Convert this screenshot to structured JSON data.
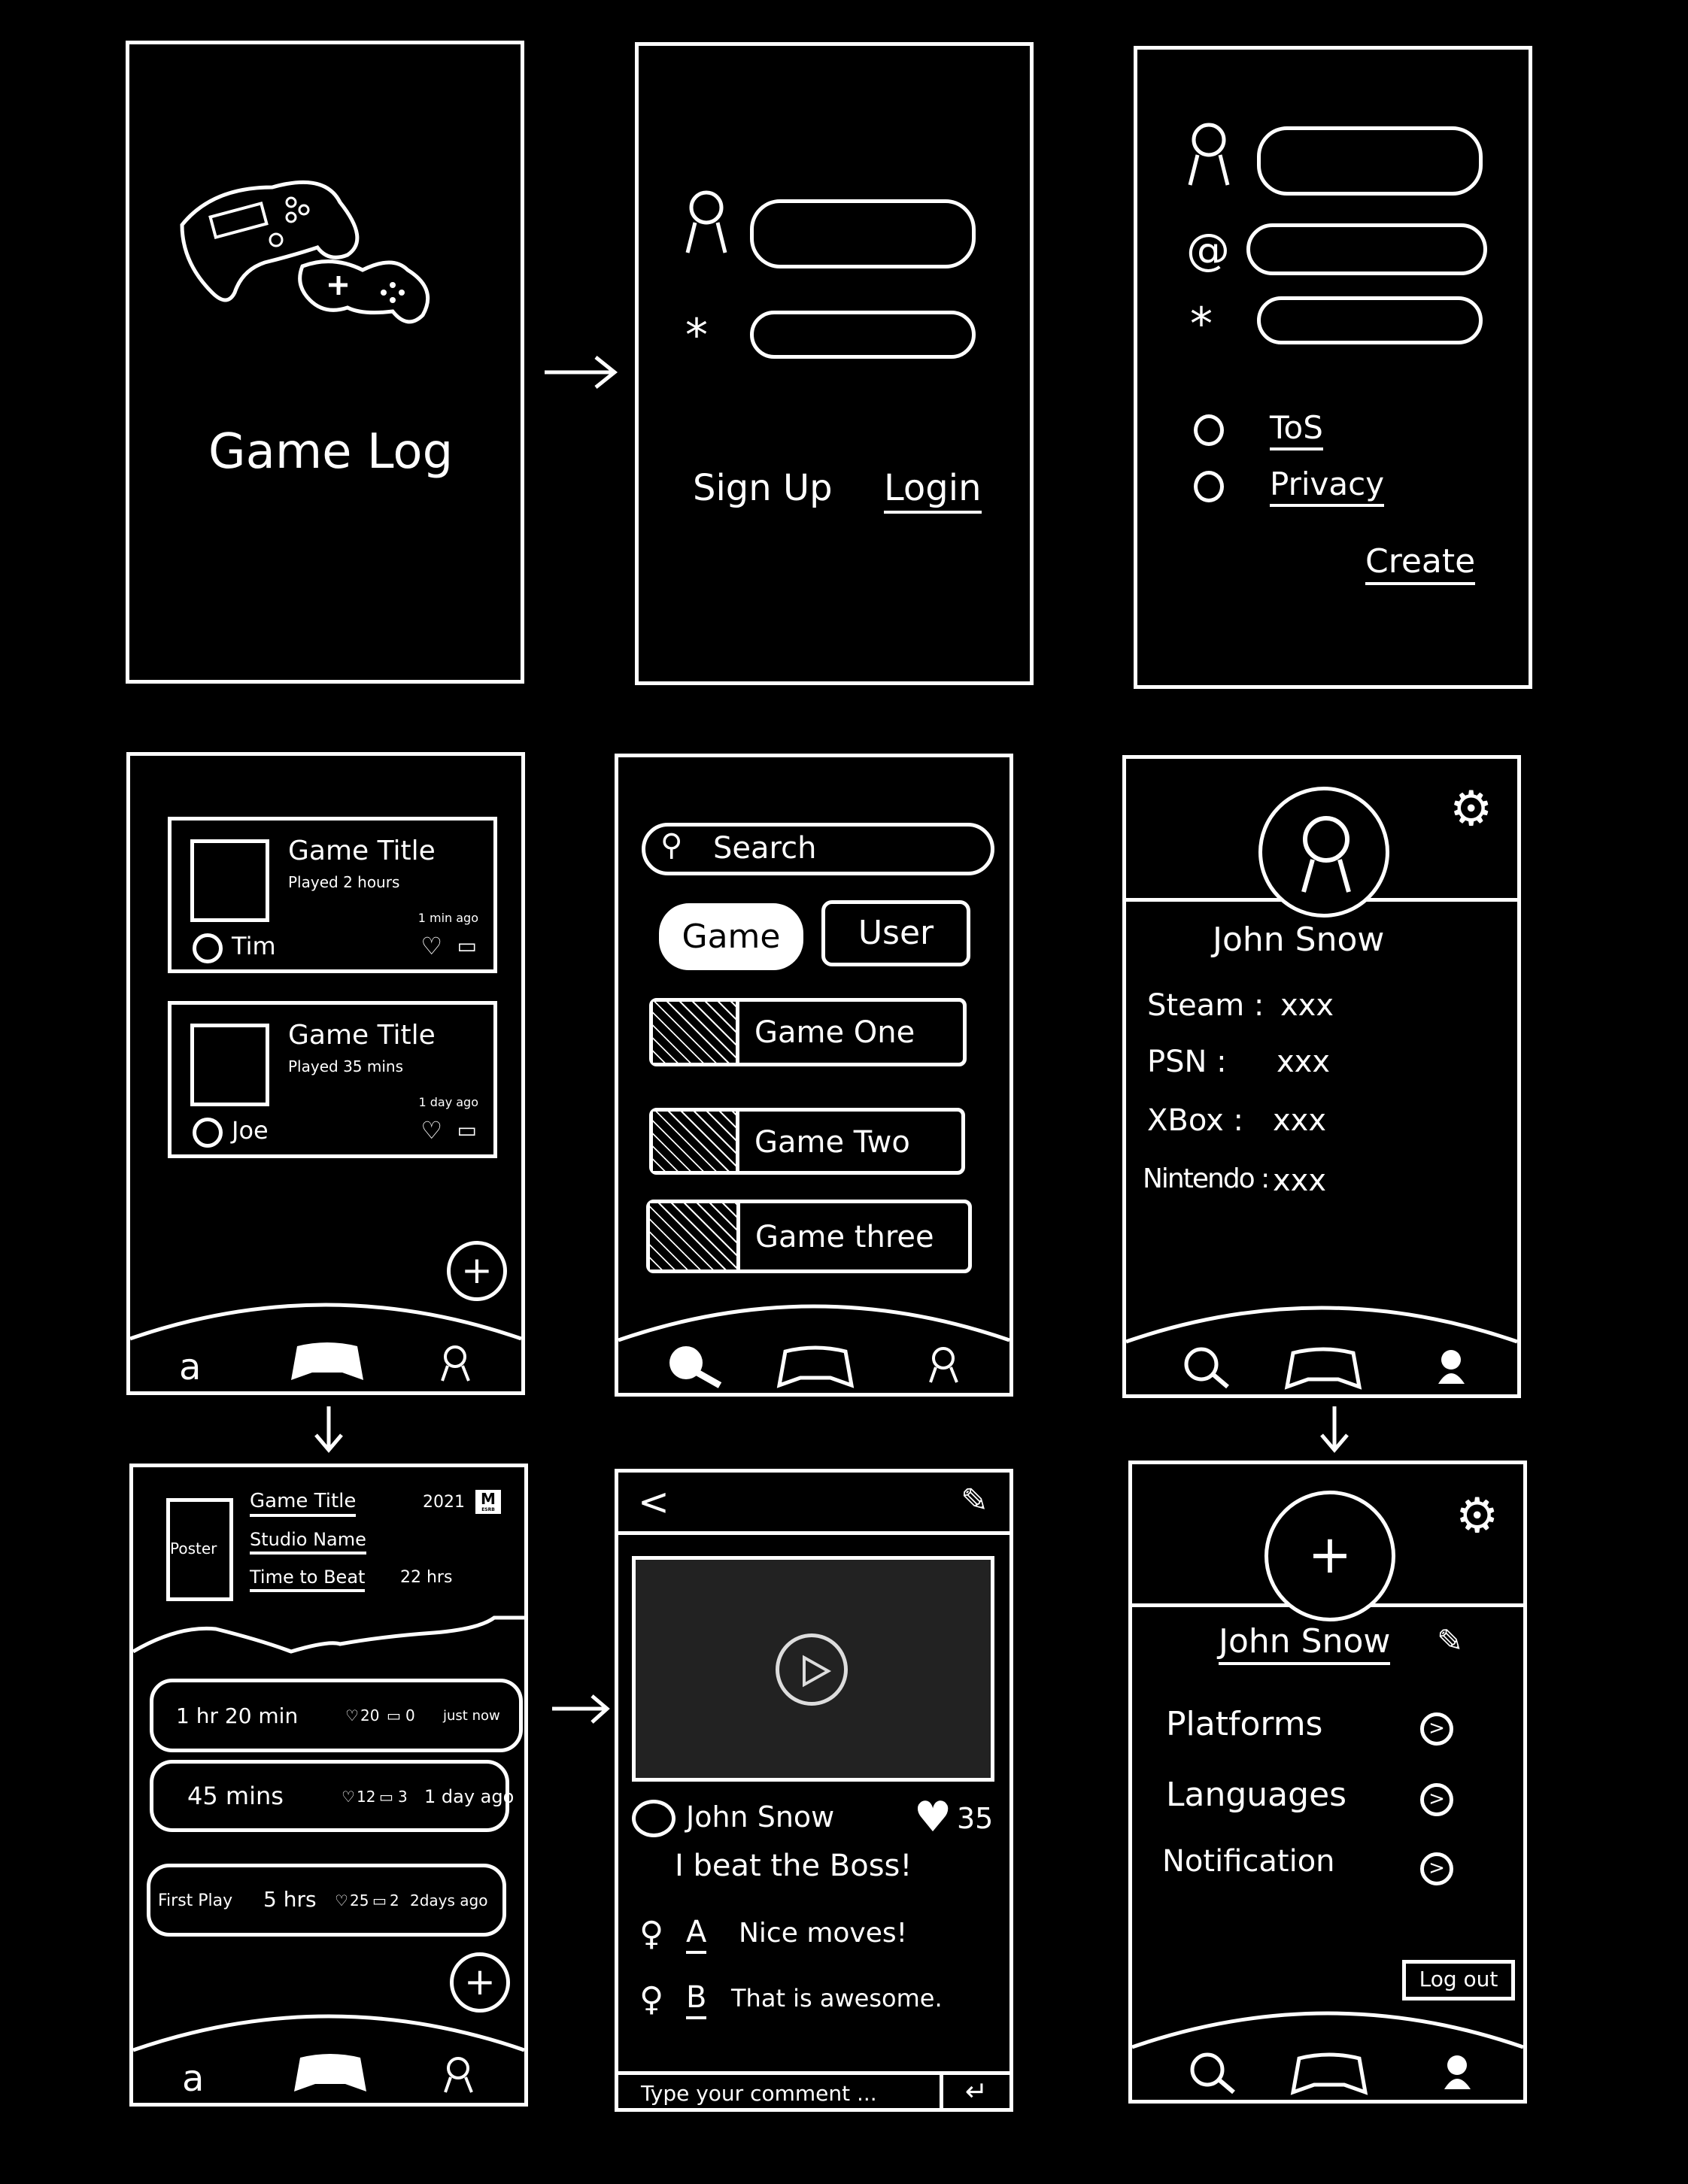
{
  "splash": {
    "title": "Game Log",
    "icon": "gamepad-icon"
  },
  "login": {
    "username_placeholder": "",
    "password_placeholder": "",
    "signup_label": "Sign Up",
    "login_label": "Login"
  },
  "signup": {
    "tos_label": "ToS",
    "privacy_label": "Privacy",
    "create_label": "Create",
    "email_symbol": "@",
    "password_symbol": "*"
  },
  "feed": {
    "posts": [
      {
        "title": "Game Title",
        "played": "Played 2 hours",
        "time": "1 min ago",
        "user": "Tim"
      },
      {
        "title": "Game Title",
        "played": "Played 35 mins",
        "time": "1 day ago",
        "user": "Joe"
      }
    ],
    "fab": "+"
  },
  "search": {
    "placeholder": "Search",
    "tabs": [
      {
        "label": "Game",
        "active": true
      },
      {
        "label": "User",
        "active": false
      }
    ],
    "results": [
      "Game One",
      "Game Two",
      "Game three"
    ]
  },
  "profile": {
    "name": "John Snow",
    "platforms": [
      {
        "label": "Steam :",
        "value": "xxx"
      },
      {
        "label": "PSN :",
        "value": "xxx"
      },
      {
        "label": "XBox :",
        "value": "xxx"
      },
      {
        "label": "Nintendo :",
        "value": "xxx"
      }
    ]
  },
  "game_detail": {
    "poster": "Poster",
    "title": "Game Title",
    "year": "2021",
    "rating": "M",
    "rating_org": "ESRB",
    "studio": "Studio Name",
    "ttb_label": "Time to Beat",
    "ttb_value": "22 hrs",
    "sessions": [
      {
        "tag": "",
        "duration": "1 hr 20 min",
        "likes": "20",
        "comments": "0",
        "time": "just now"
      },
      {
        "tag": "",
        "duration": "45 mins",
        "likes": "12",
        "comments": "3",
        "time": "1 day ago"
      },
      {
        "tag": "First Play",
        "duration": "5 hrs",
        "likes": "25",
        "comments": "2",
        "time": "2days ago"
      }
    ],
    "fab": "+"
  },
  "post": {
    "back": "<",
    "author": "John Snow",
    "likes": "35",
    "text": "I beat the Boss!",
    "comments": [
      {
        "user": "A",
        "text": "Nice moves!"
      },
      {
        "user": "B",
        "text": "That is awesome."
      }
    ],
    "comment_placeholder": "Type your comment ..."
  },
  "settings": {
    "name": "John Snow",
    "items": [
      "Platforms",
      "Languages",
      "Notification"
    ],
    "logout": "Log out"
  },
  "colors": {
    "background": "#000000",
    "stroke": "#ffffff",
    "video": "#222222"
  }
}
